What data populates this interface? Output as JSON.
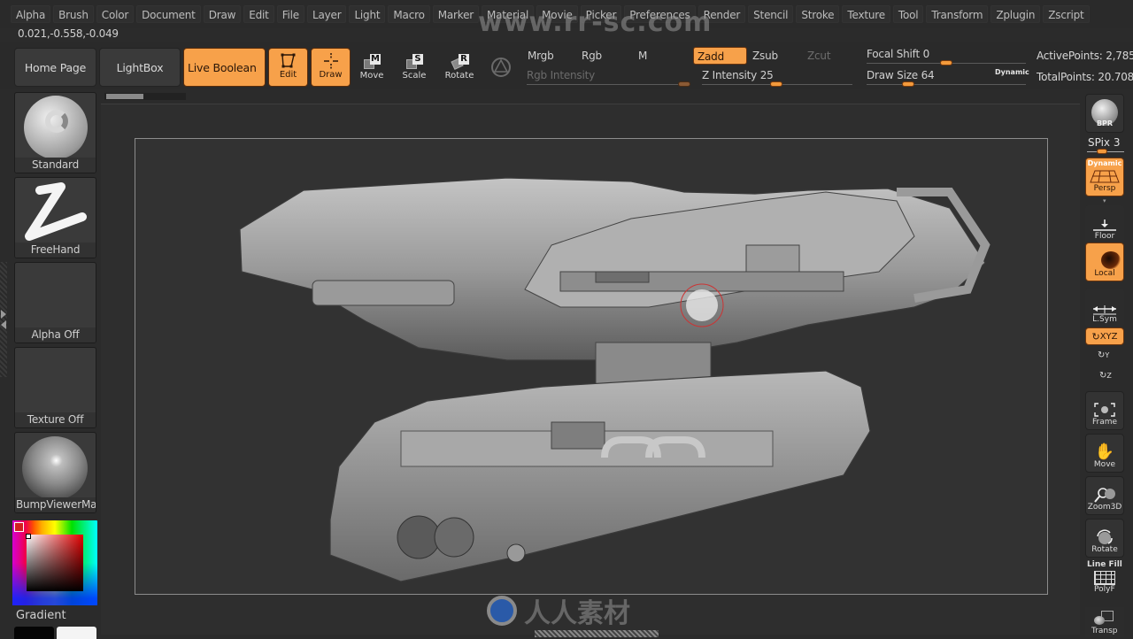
{
  "menu": [
    "Alpha",
    "Brush",
    "Color",
    "Document",
    "Draw",
    "Edit",
    "File",
    "Layer",
    "Light",
    "Macro",
    "Marker",
    "Material",
    "Movie",
    "Picker",
    "Preferences",
    "Render",
    "Stencil",
    "Stroke",
    "Texture",
    "Tool",
    "Transform",
    "Zplugin",
    "Zscript"
  ],
  "coordinates": "0.021,-0.558,-0.049",
  "shelf": {
    "home_page": "Home Page",
    "lightbox": "LightBox",
    "live_boolean": "Live Boolean",
    "edit": "Edit",
    "draw": "Draw",
    "move": "Move",
    "scale": "Scale",
    "rotate": "Rotate",
    "move_key": "M",
    "scale_key": "S",
    "rotate_key": "R"
  },
  "modes": {
    "mrgb": "Mrgb",
    "rgb": "Rgb",
    "m": "M",
    "zadd": "Zadd",
    "zsub": "Zsub",
    "zcut": "Zcut"
  },
  "sliders": {
    "rgb_intensity": {
      "label": "Rgb Intensity",
      "value": 100
    },
    "z_intensity": {
      "label": "Z Intensity",
      "value": 25
    },
    "focal_shift": {
      "label": "Focal Shift",
      "value": 0
    },
    "draw_size": {
      "label": "Draw Size",
      "value": 64
    },
    "dynamic_label": "Dynamic"
  },
  "stats": {
    "active_points": "ActivePoints: 2,785",
    "total_points": "TotalPoints: 20.708"
  },
  "left_shelf": {
    "brush": "Standard",
    "stroke": "FreeHand",
    "alpha": "Alpha Off",
    "texture": "Texture Off",
    "material": "BumpViewerMat",
    "gradient": "Gradient"
  },
  "colors": {
    "accent": "#f7a14a",
    "main_color": "#d21f1f"
  },
  "right_shelf": {
    "bpr": "BPR",
    "spix": "SPix 3",
    "spix_value": 3,
    "persp_top": "Dynamic",
    "persp": "Persp",
    "floor": "Floor",
    "local": "Local",
    "lsym": "L.Sym",
    "xyz": "XYZ",
    "y": "Y",
    "z": "Z",
    "frame": "Frame",
    "move": "Move",
    "zoom3d": "Zoom3D",
    "rotate": "Rotate",
    "line_fill": "Line Fill",
    "polyf": "PolyF",
    "transp": "Transp"
  },
  "watermark": {
    "top": "www.rr-sc.com",
    "bottom": "人人素材"
  }
}
